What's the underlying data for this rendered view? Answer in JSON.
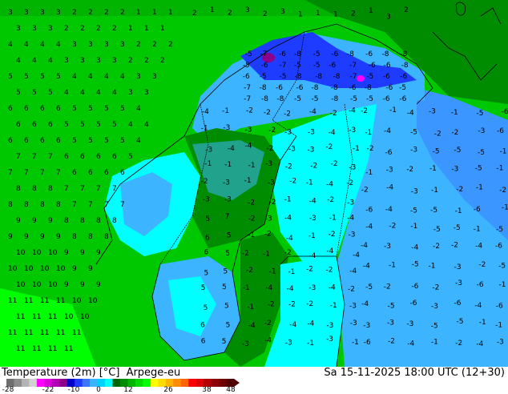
{
  "footer": {
    "variable": "Temperature (2m) [°C]",
    "model": "Arpege-eu",
    "timestamp": "Sa 15-11-2025 18:00 UTC (12+30)"
  },
  "colorbar": {
    "ticks": [
      "-28",
      "-22",
      "-10",
      "0",
      "12",
      "26",
      "38",
      "48"
    ],
    "colors": [
      "#6e6e6e",
      "#8c8c8c",
      "#b4b4b4",
      "#d2d2d2",
      "#ff00ff",
      "#dc00dc",
      "#b400b4",
      "#8c008c",
      "#0000c8",
      "#1e3cff",
      "#3c78ff",
      "#3cb4ff",
      "#00d2ff",
      "#00ffff",
      "#006400",
      "#008c00",
      "#00b400",
      "#00dc00",
      "#00ff00",
      "#ffff00",
      "#ffdc00",
      "#ffb400",
      "#ff8c00",
      "#ff6400",
      "#ff0000",
      "#dc0000",
      "#b40000",
      "#8c0000",
      "#6e0000",
      "#500000"
    ]
  },
  "map_labels": {
    "north_sea_and_norway": [
      "1",
      "2",
      "3",
      "4",
      "5",
      "6",
      "7",
      "8",
      "9",
      "10",
      "11"
    ],
    "sweden_finland": [
      "-1",
      "-2",
      "-3",
      "-4",
      "5",
      "6",
      "7"
    ],
    "lapland": [
      "-5",
      "-6",
      "-7",
      "-8"
    ],
    "russia": [
      "-1",
      "-2",
      "-3",
      "-4",
      "-5",
      "-6"
    ]
  }
}
